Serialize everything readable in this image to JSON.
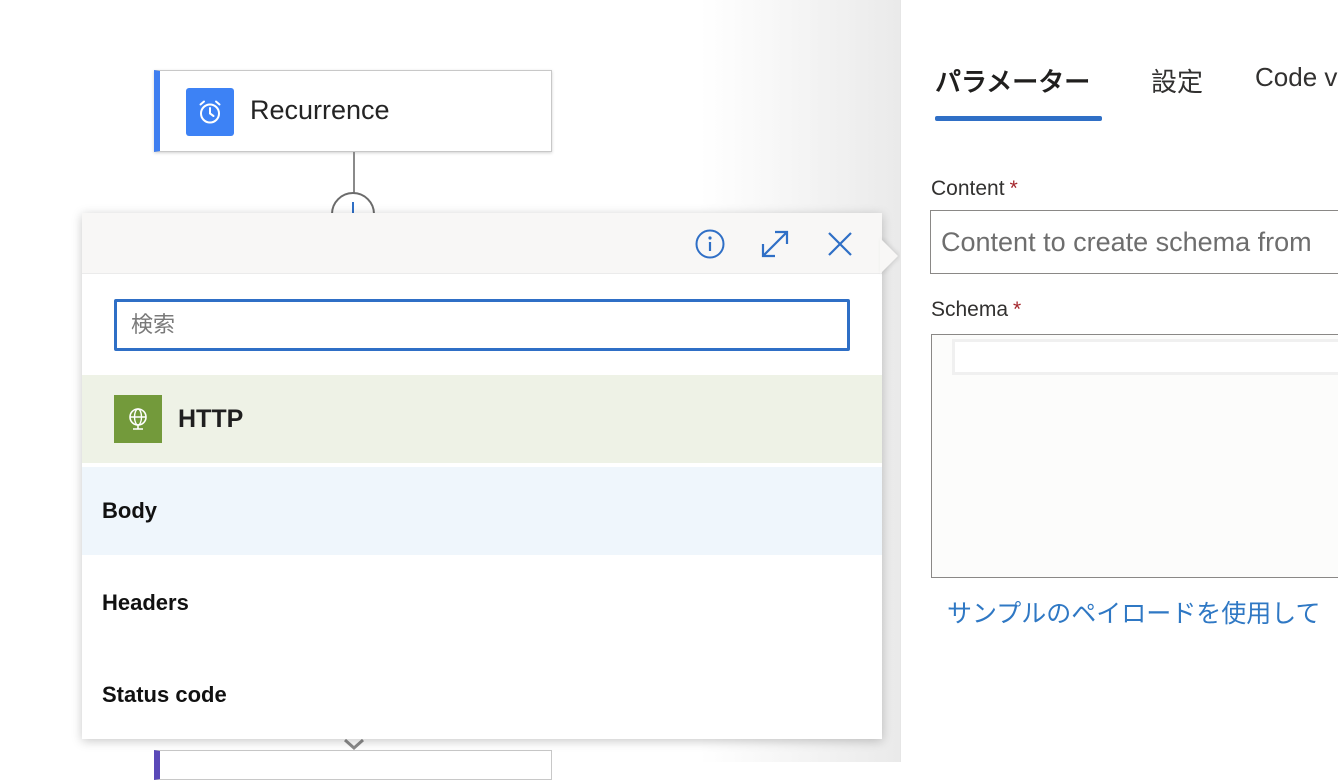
{
  "canvas": {
    "trigger_title": "Recurrence"
  },
  "flyout": {
    "search_placeholder": "検索",
    "group_title": "HTTP",
    "items": [
      "Body",
      "Headers",
      "Status code"
    ],
    "colors": {
      "accent": "#2f6fc6",
      "http_icon": "#739a3b",
      "recurrence_icon": "#3d82f5"
    }
  },
  "panel": {
    "tabs": [
      "パラメーター",
      "設定",
      "Code view"
    ],
    "content_label": "Content",
    "content_placeholder": "Content to create schema from",
    "schema_label": "Schema",
    "required_mark": "*",
    "sample_link": "サンプルのペイロードを使用して"
  }
}
